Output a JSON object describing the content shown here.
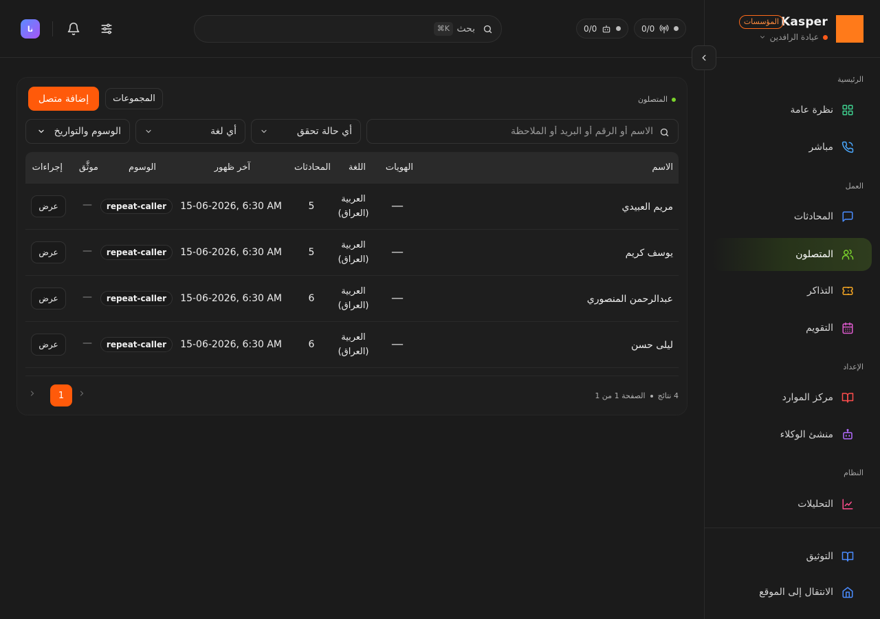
{
  "brand": {
    "name": "Kasper",
    "plan_badge": "المؤسسات",
    "org_name": "عيادة الرافدين",
    "logo_color": "#ff7a1a"
  },
  "topbar": {
    "status_calls": "0/0",
    "status_agents": "0/0",
    "search_label": "بحث",
    "search_shortcut": "⌘K",
    "avatar_initials": "نا",
    "icons": [
      "search-icon",
      "antenna-icon",
      "bot-icon",
      "bell-icon",
      "sliders-icon"
    ]
  },
  "sidebar": {
    "sections": {
      "home": "الرئيسية",
      "work": "العمل",
      "setup": "الإعداد",
      "system": "النظام"
    },
    "items": {
      "overview": "نظرة عامة",
      "live": "مباشر",
      "conversations": "المحادثات",
      "contacts": "المتصلون",
      "tickets": "التذاكر",
      "calendar": "التقويم",
      "resources": "مركز الموارد",
      "agent_builder": "منشئ الوكلاء",
      "analytics": "التحليلات"
    },
    "footer": {
      "docs": "التوثيق",
      "go_to_site": "الانتقال إلى الموقع"
    },
    "active": "contacts"
  },
  "page": {
    "breadcrumb": "المتصلون",
    "groups_button": "المجموعات",
    "add_button": "إضافة متصل",
    "accent_color": "#ff5a0a"
  },
  "filters": {
    "search_placeholder": "الاسم أو الرقم أو البريد أو الملاحظة",
    "verification": "أي حالة تحقق",
    "language": "أي لغة",
    "tags_dates": "الوسوم والتواريخ"
  },
  "table": {
    "columns": {
      "name": "الاسم",
      "identities": "الهويات",
      "language": "اللغة",
      "conversations": "المحادثات",
      "last_seen": "آخر ظهور",
      "tags": "الوسوم",
      "verified": "موثَّق",
      "actions": "إجراءات"
    },
    "rows": [
      {
        "name": "مريم العبيدي",
        "identities": "—",
        "language_line1": "العربية",
        "language_line2": "(العراق)",
        "conversations": "5",
        "last_seen": "15-06-2026, 6:30 AM",
        "tag": "repeat-caller",
        "verified": "—",
        "action": "عرض"
      },
      {
        "name": "يوسف كريم",
        "identities": "—",
        "language_line1": "العربية",
        "language_line2": "(العراق)",
        "conversations": "5",
        "last_seen": "15-06-2026, 6:30 AM",
        "tag": "repeat-caller",
        "verified": "—",
        "action": "عرض"
      },
      {
        "name": "عبدالرحمن المنصوري",
        "identities": "—",
        "language_line1": "العربية",
        "language_line2": "(العراق)",
        "conversations": "6",
        "last_seen": "15-06-2026, 6:30 AM",
        "tag": "repeat-caller",
        "verified": "—",
        "action": "عرض"
      },
      {
        "name": "ليلى حسن",
        "identities": "—",
        "language_line1": "العربية",
        "language_line2": "(العراق)",
        "conversations": "6",
        "last_seen": "15-06-2026, 6:30 AM",
        "tag": "repeat-caller",
        "verified": "—",
        "action": "عرض"
      }
    ]
  },
  "pagination": {
    "results": "4 نتائج",
    "page_info": "الصفحة 1 من 1",
    "current_page": "1"
  }
}
